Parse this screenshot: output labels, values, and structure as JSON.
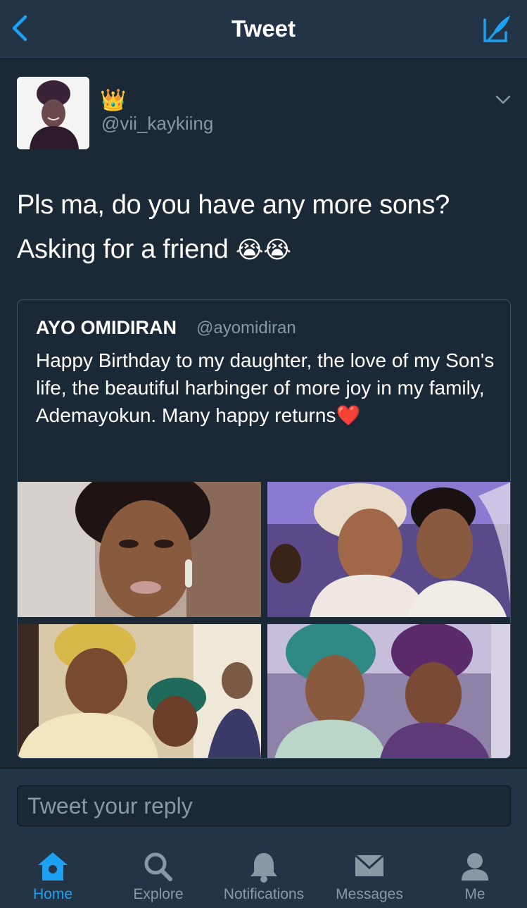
{
  "header": {
    "title": "Tweet"
  },
  "tweet": {
    "crown": "👑",
    "handle": "@vii_kaykiing",
    "line1": "Pls ma, do you have any more sons?",
    "line2": "Asking for a friend ",
    "emoji": "😭😭"
  },
  "quote": {
    "name": "AYO OMIDIRAN",
    "handle": "@ayomidiran",
    "text": "Happy Birthday to my daughter, the love of my Son's life, the beautiful harbinger of more joy in my family, Ademayokun. Many happy returns",
    "heart": "❤️"
  },
  "reply": {
    "placeholder": "Tweet your reply"
  },
  "tabs": [
    {
      "label": "Home",
      "icon": "home-icon",
      "active": true
    },
    {
      "label": "Explore",
      "icon": "search-icon"
    },
    {
      "label": "Notifications",
      "icon": "bell-icon"
    },
    {
      "label": "Messages",
      "icon": "envelope-icon"
    },
    {
      "label": "Me",
      "icon": "person-icon"
    }
  ],
  "colors": {
    "accent": "#1da1f2",
    "background": "#141d26",
    "bar": "#243447",
    "muted": "#8899a6"
  }
}
